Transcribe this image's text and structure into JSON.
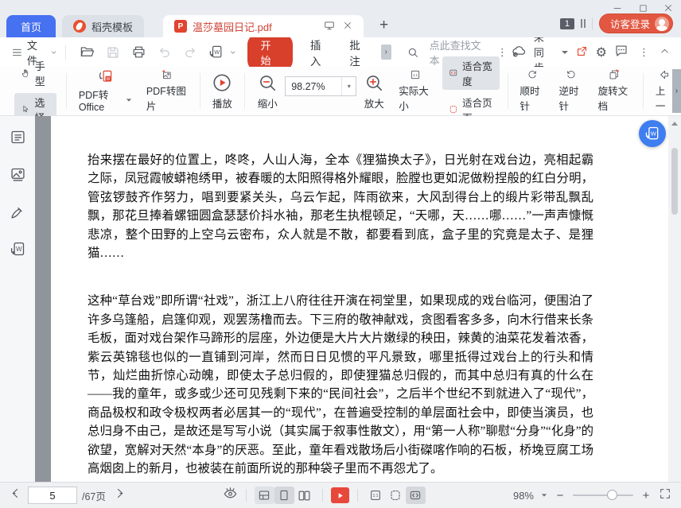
{
  "colors": {
    "accent-red": "#e0442f",
    "brand-blue": "#4671f0",
    "start-red": "#d8402c",
    "login-red": "#e25742",
    "float-blue": "#3f7ef0",
    "doc-bg": "#90959b",
    "tab-text-red": "#cf4337"
  },
  "titlebar": {
    "tabs": [
      {
        "label": "首页"
      },
      {
        "label": "稻壳模板"
      },
      {
        "label": "温莎墓园日记.pdf"
      }
    ],
    "new_tab": "+",
    "window_count": "1",
    "login_label": "访客登录"
  },
  "menubar": {
    "file": "文件",
    "start": "开始",
    "insert": "插入",
    "comment": "批注",
    "comment_expand": "›",
    "search_hint": "点此查找文本",
    "sync_status": "未同步"
  },
  "ribbon": {
    "hand": "手型",
    "select": "选择",
    "pdf_to_office": "PDF转Office",
    "pdf_to_image": "PDF转图片",
    "play": "播放",
    "zoom_out": "缩小",
    "zoom_value": "98.27%",
    "zoom_in": "放大",
    "actual_size": "实际大小",
    "fit_width": "适合宽度",
    "fit_page": "适合页面",
    "rotate_cw": "顺时针",
    "rotate_ccw": "逆时针",
    "rotate_doc": "旋转文档",
    "prev_partial": "上一",
    "expand": "›"
  },
  "glyphs": {
    "w": "W",
    "one_to_one": "1:1",
    "pdf": "P"
  },
  "document": {
    "paragraphs": [
      "抬来摆在最好的位置上，咚咚，人山人海，全本《狸猫换太子》，日光射在戏台边，亮相起霸之际，凤冠霞帔蟒袍绣甲，被春暖的太阳照得格外耀眼，脸膛也更如泥做粉捏般的红白分明，管弦锣鼓齐作努力，唱到要紧关头，乌云乍起，阵雨欲来，大风刮得台上的缎片彩带乱飘乱飘，那花旦捧着螺钿圆盒瑟瑟价抖水袖，那老生执棍顿足，“天哪，天……哪……”一声声慷慨悲凉，整个田野的上空乌云密布，众人就是不散，都要看到底，盒子里的究竟是太子、是狸猫……",
      "这种“草台戏”即所谓“社戏”，浙江上八府往往开演在祠堂里，如果现成的戏台临河，便围泊了许多乌篷船，启篷仰观，观罢荡橹而去。下三府的敬神献戏，贪图看客多多，向木行借来长条毛板，面对戏台架作马蹄形的层座，外边便是大片大片嫩绿的秧田，辣黄的油菜花发着浓香，紫云英锦毯也似的一直铺到河岸，然而日日见惯的平凡景致，哪里抵得过戏台上的行头和情节，灿烂曲折惊心动魄，即使太子总归假的，即使狸猫总归假的，而其中总归有真的什么在——我的童年，或多或少还可见残剩下来的“民间社会”，之后半个世纪不到就进入了“现代”，商品极权和政令极权两者必居其一的“现代”，在普遍受控制的单层面社会中，即使当演员，也总归身不由己，是故还是写写小说（其实属于叙事性散文），用“第一人称”聊慰“分身”“化身”的欲望，宽解对天然“本身”的厌恶。至此，童年看戏散场后小街磔喀作响的石板，桥堍豆腐工场高烟囱上的新月，也被装在前面所说的那种袋子里而不再怨尤了。"
    ]
  },
  "statusbar": {
    "page_current": "5",
    "page_total": "/67页",
    "zoom_value": "98%"
  }
}
